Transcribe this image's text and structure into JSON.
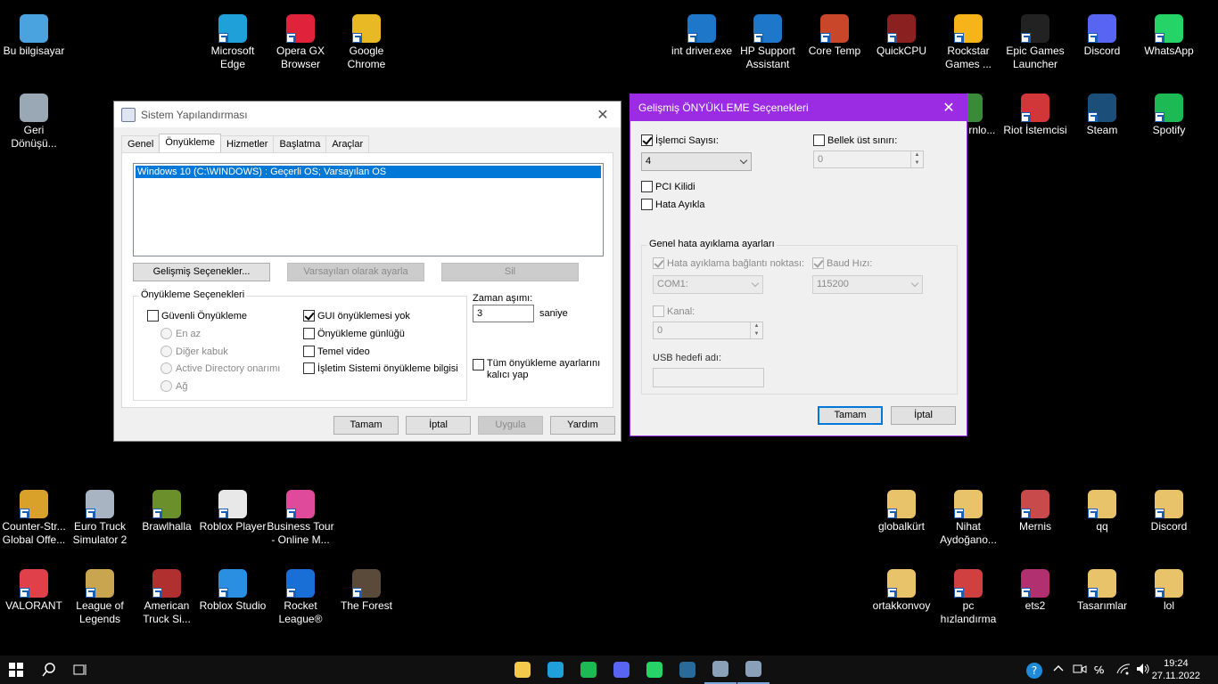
{
  "desktop": {
    "icons": [
      {
        "label": "Bu bilgisayar",
        "icon": "pc-icon",
        "color": "#4aa3df"
      },
      {
        "label": "Microsoft Edge",
        "icon": "edge-icon",
        "color": "#1fa0d8"
      },
      {
        "label": "Opera GX Browser",
        "icon": "opera-gx-icon",
        "color": "#e0233a"
      },
      {
        "label": "Google Chrome",
        "icon": "chrome-icon",
        "color": "#e9b825"
      },
      {
        "label": "int driver.exe",
        "icon": "hp-icon",
        "color": "#1e77c8"
      },
      {
        "label": "HP Support Assistant",
        "icon": "hp-support-icon",
        "color": "#1e77c8"
      },
      {
        "label": "Core Temp",
        "icon": "core-temp-icon",
        "color": "#c8462a"
      },
      {
        "label": "QuickCPU",
        "icon": "quickcpu-icon",
        "color": "#8a2020"
      },
      {
        "label": "Rockstar Games ...",
        "icon": "rockstar-icon",
        "color": "#f6b41a"
      },
      {
        "label": "Epic Games Launcher",
        "icon": "epic-icon",
        "color": "#222222"
      },
      {
        "label": "Discord",
        "icon": "discord-icon",
        "color": "#5865f2"
      },
      {
        "label": "WhatsApp",
        "icon": "whatsapp-icon",
        "color": "#25d366"
      },
      {
        "label": "Geri Dönüşü...",
        "icon": "recycle-bin-icon",
        "color": "#9aa7b4"
      },
      {
        "label": "Riot İstemcisi",
        "icon": "riot-icon",
        "color": "#d13639"
      },
      {
        "label": "Steam",
        "icon": "steam-icon",
        "color": "#1b4f7a"
      },
      {
        "label": "Spotify",
        "icon": "spotify-icon",
        "color": "#1db954"
      },
      {
        "label": "Counter-Str... Global Offe...",
        "icon": "csgo-icon",
        "color": "#d9a12a"
      },
      {
        "label": "Euro Truck Simulator 2",
        "icon": "ets2-icon",
        "color": "#a9b4c2"
      },
      {
        "label": "Brawlhalla",
        "icon": "brawlhalla-icon",
        "color": "#6b8f2a"
      },
      {
        "label": "Roblox Player",
        "icon": "roblox-icon",
        "color": "#e8e8e8"
      },
      {
        "label": "Business Tour - Online M...",
        "icon": "business-tour-icon",
        "color": "#e04a9a"
      },
      {
        "label": "globalkürt",
        "icon": "folder-icon",
        "color": "#e8c36a"
      },
      {
        "label": "Nihat Aydoğano...",
        "icon": "folder-icon",
        "color": "#e8c36a"
      },
      {
        "label": "Mernis",
        "icon": "file-icon",
        "color": "#c84a4a"
      },
      {
        "label": "qq",
        "icon": "folder-icon",
        "color": "#e8c36a"
      },
      {
        "label": "Discord",
        "icon": "folder-icon",
        "color": "#e8c36a"
      },
      {
        "label": "VALORANT",
        "icon": "valorant-icon",
        "color": "#e0404a"
      },
      {
        "label": "League of Legends",
        "icon": "lol-icon",
        "color": "#c9a550"
      },
      {
        "label": "American Truck Si...",
        "icon": "ats-icon",
        "color": "#b03030"
      },
      {
        "label": "Roblox Studio",
        "icon": "roblox-studio-icon",
        "color": "#2a8fe0"
      },
      {
        "label": "Rocket League®",
        "icon": "rocket-league-icon",
        "color": "#1a6fd6"
      },
      {
        "label": "The Forest",
        "icon": "the-forest-icon",
        "color": "#5a4a3a"
      },
      {
        "label": "ortakkonvoy",
        "icon": "folder-icon",
        "color": "#e8c36a"
      },
      {
        "label": "pc hızlandırma",
        "icon": "file-icon",
        "color": "#d04040"
      },
      {
        "label": "ets2",
        "icon": "archive-icon",
        "color": "#b03070"
      },
      {
        "label": "Tasarımlar",
        "icon": "folder-icon",
        "color": "#e8c36a"
      },
      {
        "label": "lol",
        "icon": "folder-icon",
        "color": "#e8c36a"
      },
      {
        "label": "ernet rnlo...",
        "icon": "partial-icon",
        "color": "#3a8a3a"
      }
    ]
  },
  "msconfig": {
    "title": "Sistem Yapılandırması",
    "tabs": [
      "Genel",
      "Önyükleme",
      "Hizmetler",
      "Başlatma",
      "Araçlar"
    ],
    "os_entry": "Windows 10 (C:\\WINDOWS) : Geçerli OS; Varsayılan OS",
    "advanced_btn": "Gelişmiş Seçenekler...",
    "set_default_btn": "Varsayılan olarak ayarla",
    "delete_btn": "Sil",
    "boot_options_title": "Önyükleme Seçenekleri",
    "safe_boot": "Güvenli Önyükleme",
    "radio_minimal": "En az",
    "radio_alt_shell": "Diğer kabuk",
    "radio_ad_repair": "Active Directory onarımı",
    "radio_network": "Ağ",
    "no_gui": "GUI önyüklemesi yok",
    "boot_log": "Önyükleme günlüğü",
    "base_video": "Temel video",
    "os_boot_info": "İşletim Sistemi önyükleme bilgisi",
    "timeout_label": "Zaman aşımı:",
    "timeout_value": "3",
    "timeout_unit": "saniye",
    "persistent_line1": "Tüm önyükleme ayarlarını",
    "persistent_line2": "kalıcı yap",
    "ok": "Tamam",
    "cancel": "İptal",
    "apply": "Uygula",
    "help": "Yardım"
  },
  "advanced": {
    "title": "Gelişmiş ÖNYÜKLEME Seçenekleri",
    "num_procs_label": "İşlemci Sayısı:",
    "num_procs_value": "4",
    "max_memory_label": "Bellek üst sınırı:",
    "max_memory_value": "0",
    "pci_lock": "PCI Kilidi",
    "debug": "Hata Ayıkla",
    "global_debug_title": "Genel hata ayıklama ayarları",
    "debug_port_label": "Hata ayıklama bağlantı noktası:",
    "debug_port_value": "COM1:",
    "baud_label": "Baud Hızı:",
    "baud_value": "115200",
    "channel_label": "Kanal:",
    "channel_value": "0",
    "usb_target_label": "USB hedefi adı:",
    "usb_target_value": "",
    "ok": "Tamam",
    "cancel": "İptal",
    "accent": "#9b2ce4"
  },
  "taskbar": {
    "clock_time": "19:24",
    "clock_date": "27.11.2022",
    "pinned": [
      {
        "icon": "file-explorer-icon",
        "color": "#f2c94c"
      },
      {
        "icon": "edge-icon",
        "color": "#1fa0d8"
      },
      {
        "icon": "spotify-icon",
        "color": "#1db954"
      },
      {
        "icon": "discord-icon",
        "color": "#5865f2"
      },
      {
        "icon": "whatsapp-icon",
        "color": "#25d366"
      },
      {
        "icon": "steam-icon",
        "color": "#2a6a9a"
      },
      {
        "icon": "msconfig-icon",
        "color": "#8aa0b8"
      },
      {
        "icon": "msconfig-advanced-icon",
        "color": "#8aa0b8"
      }
    ]
  }
}
